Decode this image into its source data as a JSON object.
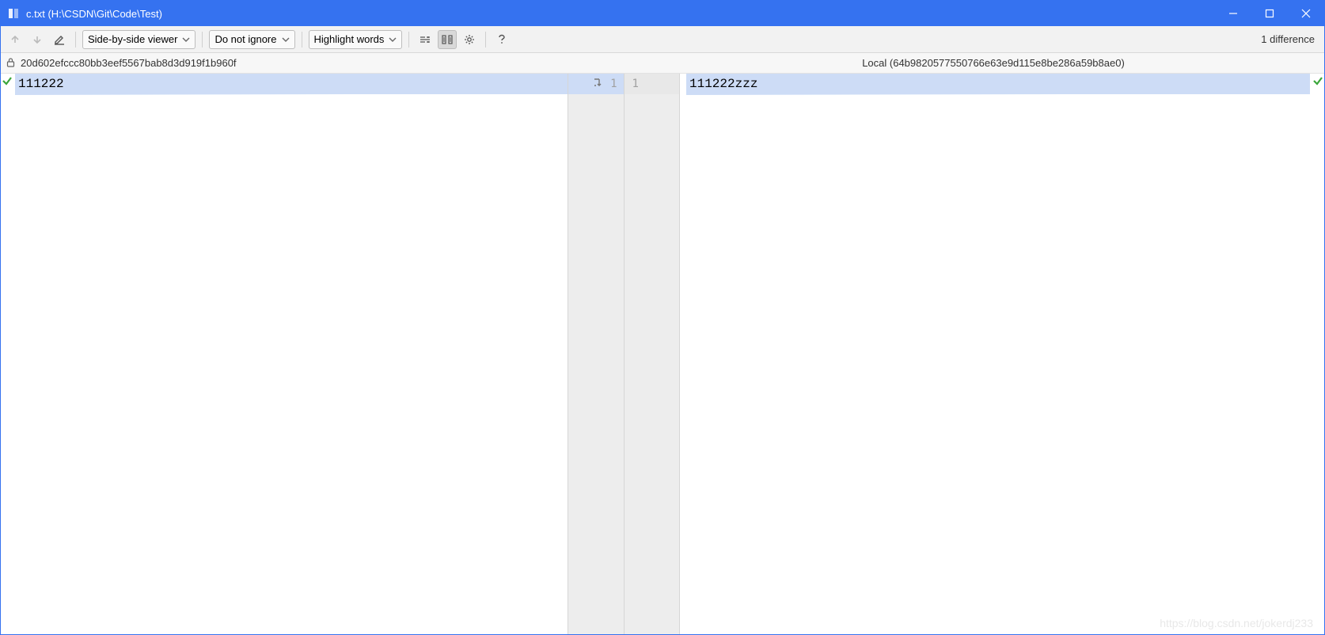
{
  "window": {
    "title": "c.txt (H:\\CSDN\\Git\\Code\\Test)"
  },
  "toolbar": {
    "viewer_mode": "Side-by-side viewer",
    "ignore_mode": "Do not ignore",
    "highlight_mode": "Highlight words",
    "diff_count_label": "1 difference"
  },
  "headers": {
    "left_label": "20d602efccc80bb3eef5567bab8d3d919f1b960f",
    "right_label": "Local (64b9820577550766e63e9d115e8be286a59b8ae0)"
  },
  "left_pane": {
    "lines": [
      {
        "num": "1",
        "text": "111222",
        "diff": true
      }
    ]
  },
  "right_pane": {
    "lines": [
      {
        "num": "1",
        "text": "111222zzz",
        "diff": true
      }
    ]
  },
  "watermark": "https://blog.csdn.net/jokerdj233"
}
